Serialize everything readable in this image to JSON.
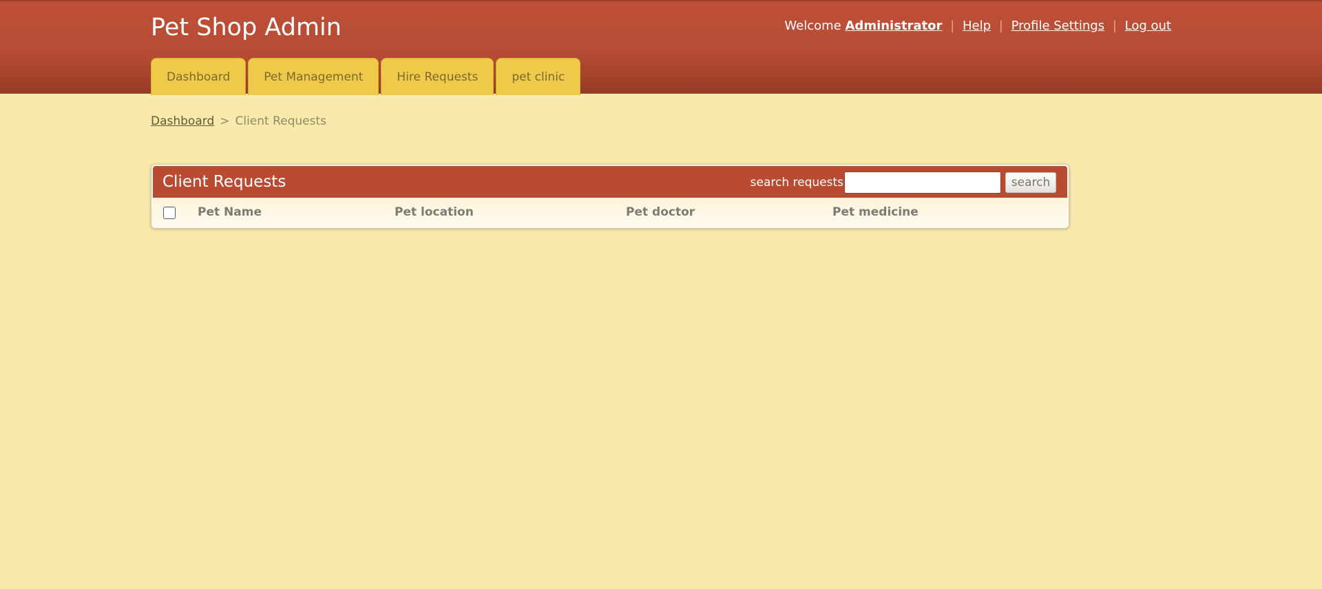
{
  "app": {
    "title": "Pet Shop Admin"
  },
  "user_nav": {
    "welcome": "Welcome",
    "user_name": "Administrator",
    "separator": "|",
    "help": "Help",
    "profile_settings": "Profile Settings",
    "logout": "Log out"
  },
  "tabs": [
    {
      "label": "Dashboard"
    },
    {
      "label": "Pet Management"
    },
    {
      "label": "Hire Requests"
    },
    {
      "label": "pet clinic"
    }
  ],
  "breadcrumb": {
    "home": "Dashboard",
    "separator": ">",
    "current": "Client Requests"
  },
  "panel": {
    "title": "Client Requests",
    "search_label": "search requests",
    "search_value": "",
    "search_button": "search",
    "columns": [
      "Pet Name",
      "Pet location",
      "Pet doctor",
      "Pet medicine"
    ],
    "select_all_checked": false
  },
  "colors": {
    "header": "#b94b33",
    "tab": "#efca4a",
    "page_background": "#f9eaab"
  }
}
